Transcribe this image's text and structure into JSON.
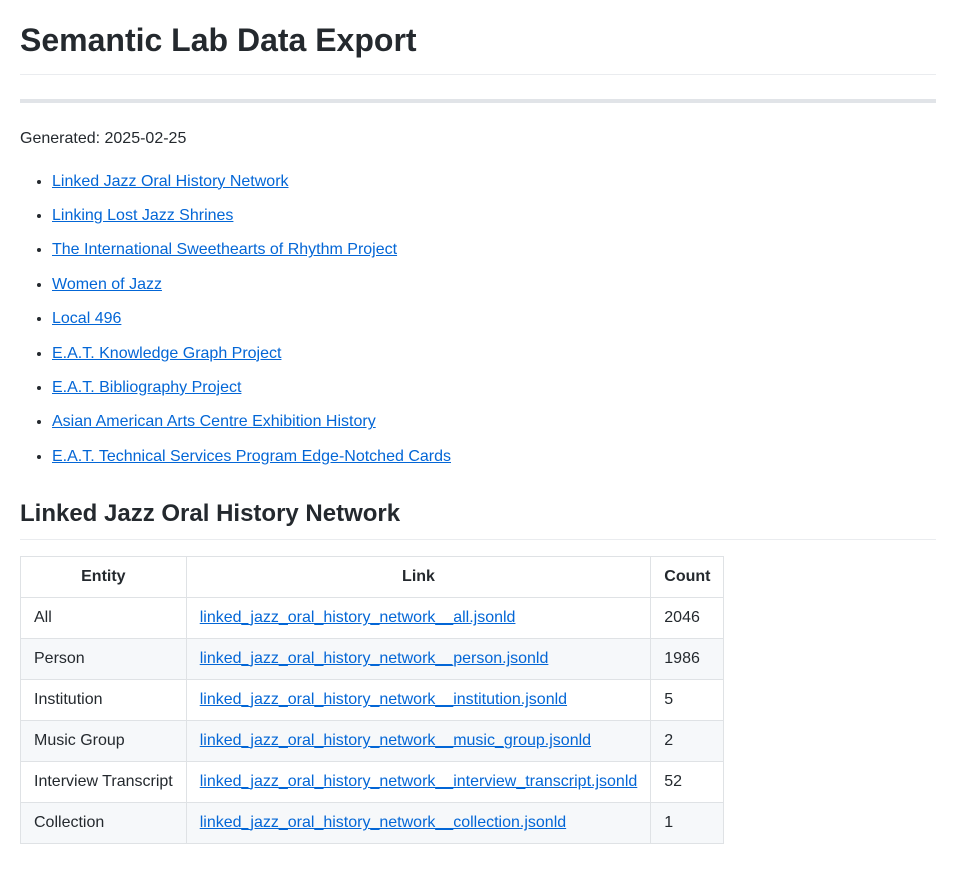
{
  "title": "Semantic Lab Data Export",
  "generated_label": "Generated: 2025-02-25",
  "toc": [
    "Linked Jazz Oral History Network",
    "Linking Lost Jazz Shrines",
    "The International Sweethearts of Rhythm Project",
    "Women of Jazz",
    "Local 496",
    "E.A.T. Knowledge Graph Project",
    "E.A.T. Bibliography Project",
    "Asian American Arts Centre Exhibition History",
    "E.A.T. Technical Services Program Edge-Notched Cards"
  ],
  "section": {
    "heading": "Linked Jazz Oral History Network",
    "columns": {
      "entity": "Entity",
      "link": "Link",
      "count": "Count"
    },
    "rows": [
      {
        "entity": "All",
        "link": "linked_jazz_oral_history_network__all.jsonld",
        "count": "2046"
      },
      {
        "entity": "Person",
        "link": "linked_jazz_oral_history_network__person.jsonld",
        "count": "1986"
      },
      {
        "entity": "Institution",
        "link": "linked_jazz_oral_history_network__institution.jsonld",
        "count": "5"
      },
      {
        "entity": "Music Group",
        "link": "linked_jazz_oral_history_network__music_group.jsonld",
        "count": "2"
      },
      {
        "entity": "Interview Transcript",
        "link": "linked_jazz_oral_history_network__interview_transcript.jsonld",
        "count": "52"
      },
      {
        "entity": "Collection",
        "link": "linked_jazz_oral_history_network__collection.jsonld",
        "count": "1"
      }
    ]
  }
}
